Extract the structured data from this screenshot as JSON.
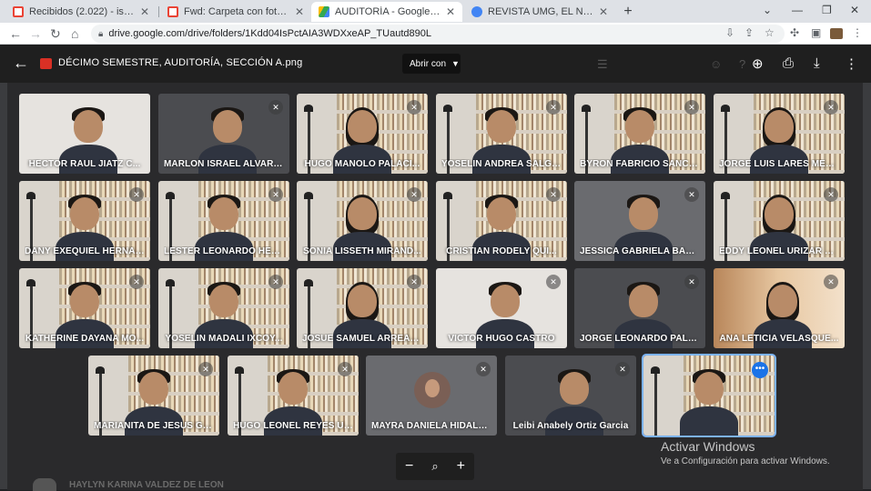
{
  "browser": {
    "tabs": [
      {
        "label": "Recibidos (2.022) - isabellanoriega...",
        "icon": "gmail-icon",
        "active": false
      },
      {
        "label": "Fwd: Carpeta con fotografías para...",
        "icon": "gmail-icon",
        "active": false
      },
      {
        "label": "AUDITORÍA - Google Drive",
        "icon": "drive-icon",
        "active": true
      },
      {
        "label": "REVISTA UMG, EL NARANJO - Re...",
        "icon": "chrome-icon",
        "active": false
      }
    ],
    "new_tab": "+",
    "url": "drive.google.com/drive/folders/1Kdd04IsPctAIA3WDXxeAP_TUautd890L"
  },
  "viewer": {
    "file_title": "DÉCIMO SEMESTRE, AUDITORÍA, SECCIÓN A.png",
    "open_with": "Abrir con",
    "zoom_minus": "−",
    "zoom_plus": "+"
  },
  "participants": [
    {
      "name": "HECTOR RAUL JIATZ C...",
      "style": "white",
      "muted": false
    },
    {
      "name": "MARLON ISRAEL ALVARA...",
      "style": "dark",
      "muted": true
    },
    {
      "name": "HUGO MANOLO PALACI...",
      "style": "shelf",
      "muted": true
    },
    {
      "name": "YOSELIN ANDREA SALGU...",
      "style": "shelf",
      "muted": true
    },
    {
      "name": "BYRON FABRICIO SANCH...",
      "style": "shelf",
      "muted": true
    },
    {
      "name": "JORGE LUIS LARES MEN...",
      "style": "shelf",
      "muted": true
    },
    {
      "name": "DANY EXEQUIEL HERNAN...",
      "style": "shelf",
      "muted": true
    },
    {
      "name": "LESTER LEONARDO HER...",
      "style": "shelf",
      "muted": true
    },
    {
      "name": "SONIA LISSETH MIRAND...",
      "style": "shelf",
      "muted": true
    },
    {
      "name": "CRISTIAN RODELY QUI...",
      "style": "shelf",
      "muted": true
    },
    {
      "name": "JESSICA GABRIELA BAUT...",
      "style": "gray",
      "muted": true
    },
    {
      "name": "EDDY LEONEL URIZAR M...",
      "style": "shelf",
      "muted": true
    },
    {
      "name": "KATHERINE DAYANA MO...",
      "style": "shelf",
      "muted": true
    },
    {
      "name": "YOSELIN MADALI IXCOY...",
      "style": "shelf",
      "muted": true
    },
    {
      "name": "JOSUE SAMUEL ARREAG...",
      "style": "shelf",
      "muted": true
    },
    {
      "name": "VICTOR HUGO CASTRO",
      "style": "white",
      "muted": true
    },
    {
      "name": "JORGE LEONARDO PALE...",
      "style": "dark",
      "muted": true
    },
    {
      "name": "ANA LETICIA VELASQUE...",
      "style": "warm",
      "muted": true
    },
    {
      "name": "MARIANITA DE JESUS GA...",
      "style": "shelf",
      "muted": true
    },
    {
      "name": "HUGO LEONEL REYES UR...",
      "style": "shelf",
      "muted": true
    },
    {
      "name": "MAYRA DANIELA HIDALG...",
      "style": "avatar",
      "muted": true
    },
    {
      "name": "Leibi Anabely Ortiz Garcia",
      "style": "dark",
      "muted": true
    },
    {
      "name": "",
      "style": "shelf-selected",
      "muted": false
    }
  ],
  "behind_text": "HAYLYN KARINA VALDEZ DE LEON",
  "activation": {
    "title": "Activar Windows",
    "subtitle": "Ve a Configuración para activar Windows."
  }
}
